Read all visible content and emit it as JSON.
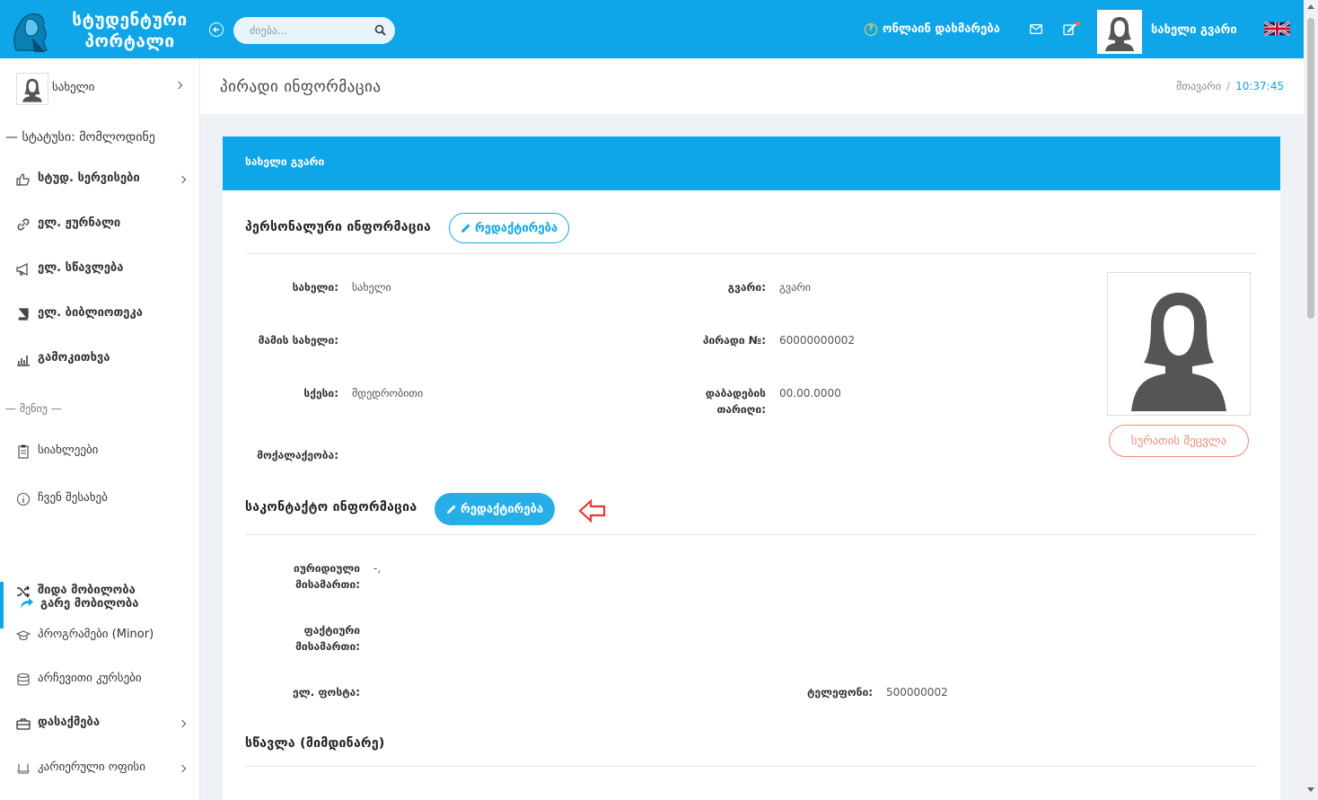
{
  "header": {
    "logo_line1": "სტუდენტური",
    "logo_line2": "პორტალი",
    "search_placeholder": "ძიება...",
    "help_label": "ონლაინ დახმარება",
    "user_name": "სახელი გვარი",
    "accent_color": "#0ea6e8"
  },
  "sidebar": {
    "profile_name": "სახელი",
    "status": "— სტატუსი: მომლოდინე",
    "items": [
      {
        "label": "სტუდ. სერვისები",
        "icon": "thumbs-up-icon",
        "bold": true
      },
      {
        "label": "ელ. ჟურნალი",
        "icon": "link-icon",
        "bold": true
      },
      {
        "label": "ელ. სწავლება",
        "icon": "megaphone-icon",
        "bold": true
      },
      {
        "label": "ელ. ბიბლიოთეკა",
        "icon": "book-icon",
        "bold": true
      },
      {
        "label": "გამოკითხვა",
        "icon": "bar-chart-icon",
        "bold": true
      }
    ],
    "menu_section": "— მენიუ —",
    "menu_items": [
      {
        "label": "სიახლეები",
        "icon": "clipboard-icon"
      },
      {
        "label": "ჩვენ შესახებ",
        "icon": "info-icon"
      },
      {
        "label": "გარე მობილობა",
        "icon": "share-icon"
      },
      {
        "label": "შიდა მობილობა",
        "icon": "shuffle-icon"
      },
      {
        "label": "პროგრამები (Minor)",
        "icon": "graduation-cap-icon"
      },
      {
        "label": "არჩევითი კურსები",
        "icon": "database-icon"
      },
      {
        "label": "დასაქმება",
        "icon": "briefcase-icon"
      },
      {
        "label": "კარიერული ოფისი",
        "icon": "desk-icon"
      }
    ]
  },
  "page": {
    "title": "პირადი ინფორმაცია",
    "breadcrumb_home": "მთავარი",
    "breadcrumb_sep": "/",
    "time": "10:37:45"
  },
  "card": {
    "title": "სახელი გვარი",
    "personal": {
      "title": "პერსონალური ინფორმაცია",
      "edit_label": "რედაქტირება",
      "fields": {
        "first_name_label": "სახელი:",
        "first_name_value": "სახელი",
        "last_name_label": "გვარი:",
        "last_name_value": "გვარი",
        "father_label": "მამის სახელი:",
        "personal_no_label": "პირადი №:",
        "personal_no_value": "60000000002",
        "gender_label": "სქესი:",
        "gender_value": "მდედრობითი",
        "birth_label_1": "დაბადების",
        "birth_label_2": "თარიღი:",
        "birth_value": "00.00.0000",
        "citizenship_label": "მოქალაქეობა:"
      },
      "change_photo": "სურათის შეცვლა"
    },
    "contact": {
      "title": "საკონტაქტო ინფორმაცია",
      "edit_label": "რედაქტირება",
      "legal_address_label_1": "იურიდიული",
      "legal_address_label_2": "მისამართი:",
      "legal_address_value": "-,",
      "actual_address_label_1": "ფაქტიური",
      "actual_address_label_2": "მისამართი:",
      "email_label": "ელ. ფოსტა:",
      "phone_label": "ტელეფონი:",
      "phone_value": "500000002"
    },
    "education_title": "სწავლა (მიმდინარე)"
  }
}
